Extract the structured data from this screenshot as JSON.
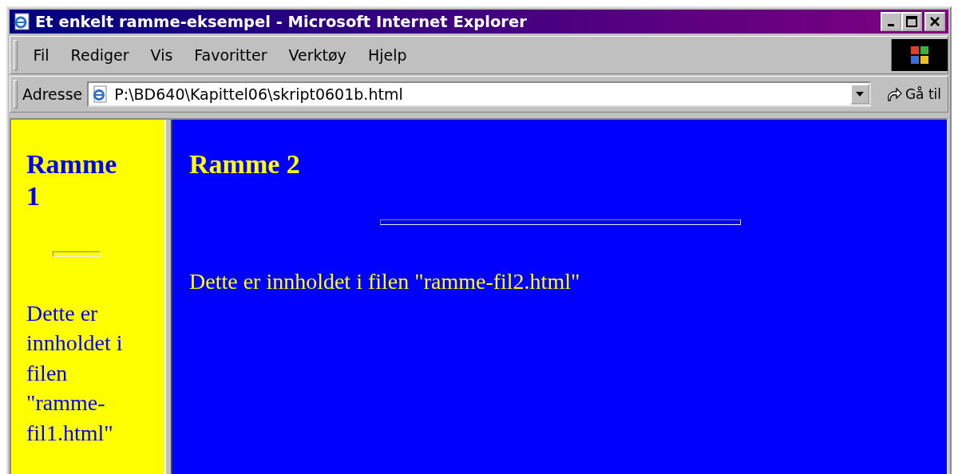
{
  "window": {
    "title": "Et enkelt ramme-eksempel - Microsoft Internet Explorer"
  },
  "menu": [
    "Fil",
    "Rediger",
    "Vis",
    "Favoritter",
    "Verktøy",
    "Hjelp"
  ],
  "address_bar": {
    "label": "Adresse",
    "value": "P:\\BD640\\Kapittel06\\skript0601b.html",
    "go_button": "Gå til"
  },
  "frames": [
    {
      "heading": "Ramme 1",
      "text": "Dette er innholdet i filen \"ramme-fil1.html\"",
      "color": "#ffff00",
      "kind": "narrow"
    },
    {
      "heading": "Ramme 2",
      "text": "Dette er innholdet i filen \"ramme-fil2.html\"",
      "color": "#0000ff",
      "kind": "wide"
    }
  ]
}
